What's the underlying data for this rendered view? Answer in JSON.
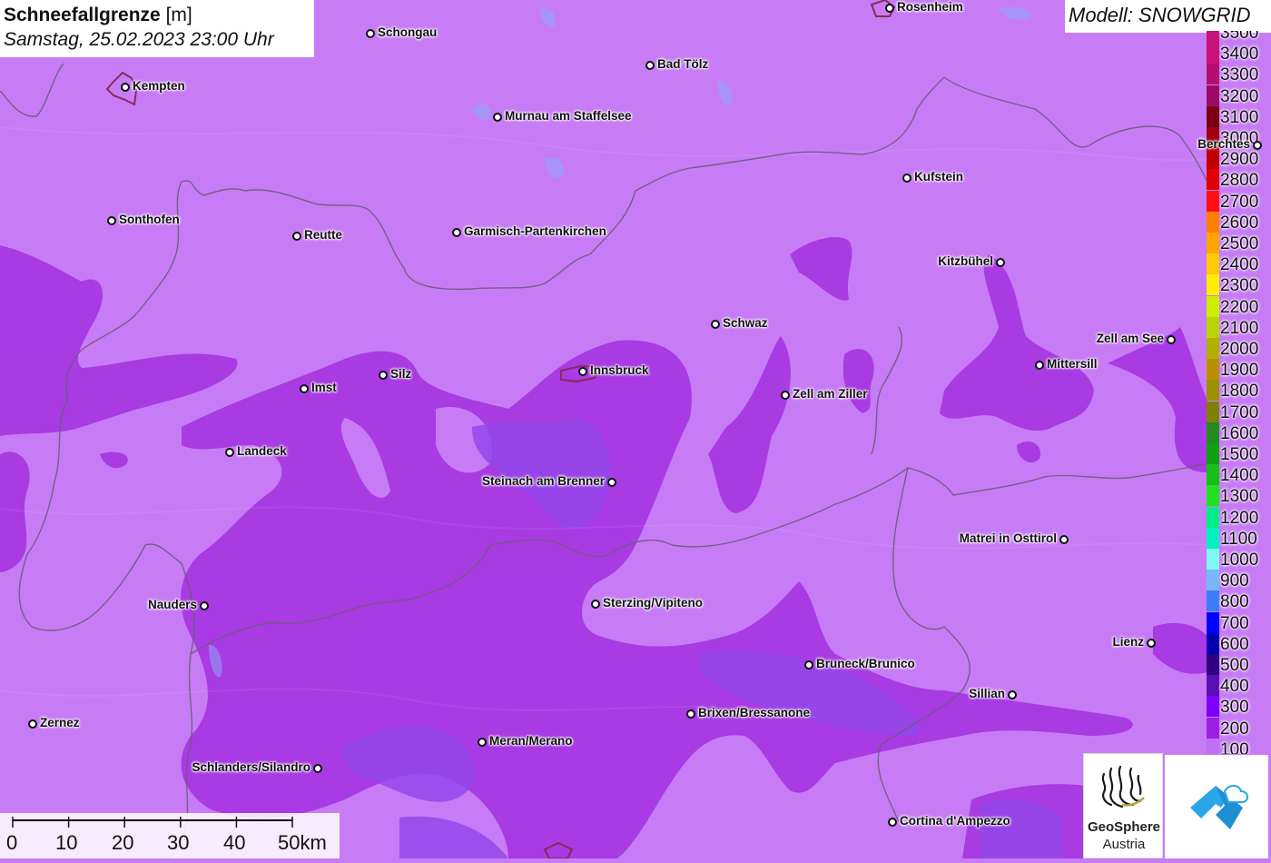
{
  "title": {
    "bold": "Schneefallgrenze",
    "unit": " [m]",
    "datetime": "Samstag, 25.02.2023 23:00 Uhr"
  },
  "model": "Modell: SNOWGRID",
  "legend": [
    {
      "label": "3500",
      "color": "#c8127a"
    },
    {
      "label": "3400",
      "color": "#c8127a"
    },
    {
      "label": "3300",
      "color": "#b40f6e"
    },
    {
      "label": "3200",
      "color": "#9c0a66"
    },
    {
      "label": "3100",
      "color": "#7a0010"
    },
    {
      "label": "3000",
      "color": "#a00010"
    },
    {
      "label": "2900",
      "color": "#c00000"
    },
    {
      "label": "2800",
      "color": "#e00000"
    },
    {
      "label": "2700",
      "color": "#ff1010"
    },
    {
      "label": "2600",
      "color": "#ff8000"
    },
    {
      "label": "2500",
      "color": "#ffa500"
    },
    {
      "label": "2400",
      "color": "#ffc800"
    },
    {
      "label": "2300",
      "color": "#ffee00"
    },
    {
      "label": "2200",
      "color": "#ccee00"
    },
    {
      "label": "2100",
      "color": "#bbd400"
    },
    {
      "label": "2000",
      "color": "#b0b000"
    },
    {
      "label": "1900",
      "color": "#b89000"
    },
    {
      "label": "1800",
      "color": "#9a9000"
    },
    {
      "label": "1700",
      "color": "#808000"
    },
    {
      "label": "1600",
      "color": "#228b22"
    },
    {
      "label": "1500",
      "color": "#12a012"
    },
    {
      "label": "1400",
      "color": "#16c016"
    },
    {
      "label": "1300",
      "color": "#20e020"
    },
    {
      "label": "1200",
      "color": "#00ee88"
    },
    {
      "label": "1100",
      "color": "#00f0c0"
    },
    {
      "label": "1000",
      "color": "#80f8f8"
    },
    {
      "label": "900",
      "color": "#78b8f8"
    },
    {
      "label": "800",
      "color": "#3c7cf8"
    },
    {
      "label": "700",
      "color": "#0000ff"
    },
    {
      "label": "600",
      "color": "#0000b0"
    },
    {
      "label": "500",
      "color": "#300080"
    },
    {
      "label": "400",
      "color": "#5a10b0"
    },
    {
      "label": "300",
      "color": "#8000ff"
    },
    {
      "label": "200",
      "color": "#9a20e0"
    },
    {
      "label": "100",
      "color": "#c070f0"
    }
  ],
  "cities": [
    {
      "name": "Rosenheim",
      "side": "right"
    },
    {
      "name": "Schongau",
      "side": "right"
    },
    {
      "name": "Bad Tölz",
      "side": "right"
    },
    {
      "name": "Kempten",
      "side": "right"
    },
    {
      "name": "Murnau am Staffelsee",
      "side": "right"
    },
    {
      "name": "Berchtes",
      "side": "left"
    },
    {
      "name": "Kufstein",
      "side": "right"
    },
    {
      "name": "Sonthofen",
      "side": "right"
    },
    {
      "name": "Reutte",
      "side": "right"
    },
    {
      "name": "Garmisch-Partenkirchen",
      "side": "right"
    },
    {
      "name": "Kitzbühel",
      "side": "left"
    },
    {
      "name": "Schwaz",
      "side": "right"
    },
    {
      "name": "Zell am See",
      "side": "left"
    },
    {
      "name": "Mittersill",
      "side": "right"
    },
    {
      "name": "Imst",
      "side": "right"
    },
    {
      "name": "Silz",
      "side": "right"
    },
    {
      "name": "Innsbruck",
      "side": "right"
    },
    {
      "name": "Zell am Ziller",
      "side": "right"
    },
    {
      "name": "Landeck",
      "side": "right"
    },
    {
      "name": "Steinach am Brenner",
      "side": "left"
    },
    {
      "name": "Matrei in Osttirol",
      "side": "left"
    },
    {
      "name": "Nauders",
      "side": "left"
    },
    {
      "name": "Sterzing/Vipiteno",
      "side": "right"
    },
    {
      "name": "Lienz",
      "side": "left"
    },
    {
      "name": "Bruneck/Brunico",
      "side": "right"
    },
    {
      "name": "Sillian",
      "side": "left"
    },
    {
      "name": "Brixen/Bressanone",
      "side": "right"
    },
    {
      "name": "Zernez",
      "side": "right"
    },
    {
      "name": "Meran/Merano",
      "side": "right"
    },
    {
      "name": "Schlanders/Silandro",
      "side": "left"
    },
    {
      "name": "Cortina d'Ampezzo",
      "side": "right"
    }
  ],
  "scale": {
    "labels": [
      "0",
      "10",
      "20",
      "30",
      "40",
      "50km"
    ]
  },
  "logos": {
    "geosphere_name": "GeoSphere",
    "geosphere_sub": "Austria"
  },
  "colors": {
    "level_100": "#c77cf5",
    "level_200": "#a633e0",
    "level_300": "#9a44ee",
    "border": "#6e5b7e"
  }
}
